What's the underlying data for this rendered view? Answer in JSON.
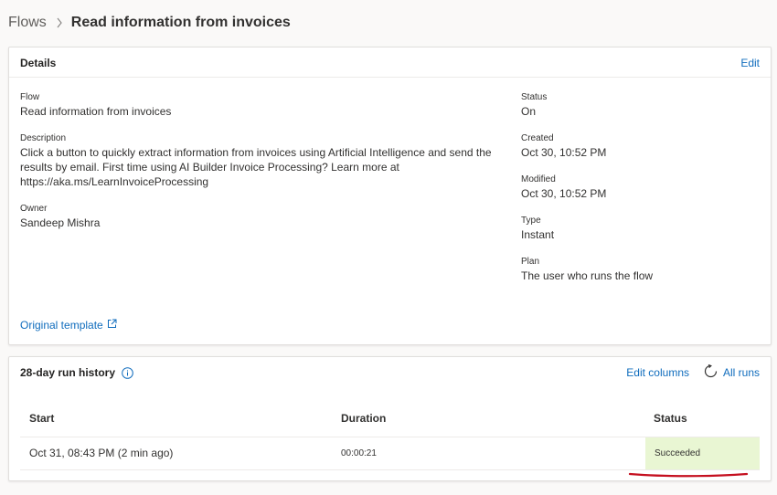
{
  "breadcrumb": {
    "root": "Flows",
    "current": "Read information from invoices"
  },
  "details": {
    "title": "Details",
    "edit_label": "Edit",
    "flow_label": "Flow",
    "flow_value": "Read information from invoices",
    "description_label": "Description",
    "description_value": "Click a button to quickly extract information from invoices using Artificial Intelligence and send the results by email. First time using AI Builder Invoice Processing? Learn more at https://aka.ms/LearnInvoiceProcessing",
    "owner_label": "Owner",
    "owner_value": "Sandeep Mishra",
    "status_label": "Status",
    "status_value": "On",
    "created_label": "Created",
    "created_value": "Oct 30, 10:52 PM",
    "modified_label": "Modified",
    "modified_value": "Oct 30, 10:52 PM",
    "type_label": "Type",
    "type_value": "Instant",
    "plan_label": "Plan",
    "plan_value": "The user who runs the flow",
    "original_template_label": "Original template"
  },
  "run_history": {
    "title": "28-day run history",
    "edit_columns_label": "Edit columns",
    "all_runs_label": "All runs",
    "columns": [
      "Start",
      "Duration",
      "Status"
    ],
    "rows": [
      {
        "start": "Oct 31, 08:43 PM (2 min ago)",
        "duration": "00:00:21",
        "status": "Succeeded"
      }
    ]
  },
  "colors": {
    "link": "#0f6cbd",
    "success_bg": "#e9f6d3",
    "annotation_red": "#c50f1f"
  },
  "icons": [
    "chevron-right-icon",
    "external-link-icon",
    "info-icon",
    "refresh-icon"
  ]
}
